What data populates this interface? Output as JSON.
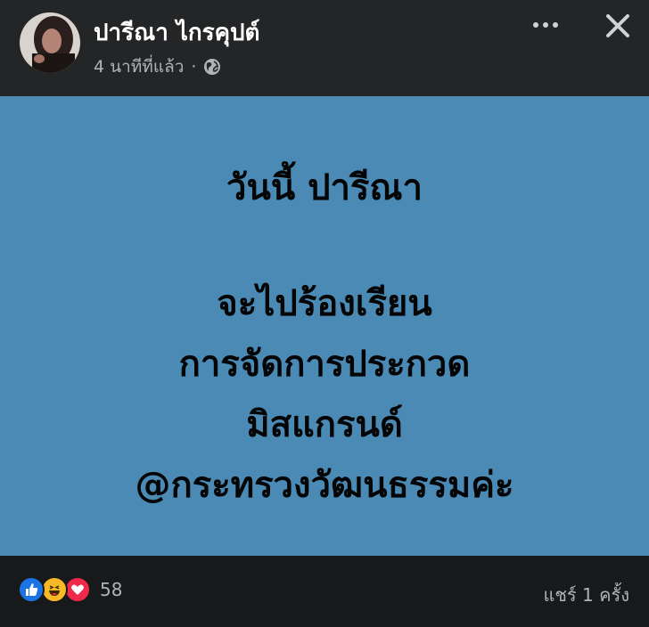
{
  "post": {
    "author": "ปารีณา ไกรคุปต์",
    "time_ago": "4 นาทีที่แล้ว",
    "separator": "·",
    "privacy_icon": "globe-icon",
    "lines": [
      "วันนี้ ปารีณา",
      "จะไปร้องเรียน",
      "การจัดการประกวด",
      "มิสแกรนด์",
      "@กระทรวงวัฒนธรรมค่ะ"
    ],
    "background_color": "#4a8ab5"
  },
  "header": {
    "more_icon": "more-horizontal-icon",
    "close_icon": "close-icon"
  },
  "footer": {
    "reactions": [
      "like-icon",
      "haha-icon",
      "love-icon"
    ],
    "reaction_count": "58",
    "shares": "แชร์ 1 ครั้ง"
  }
}
